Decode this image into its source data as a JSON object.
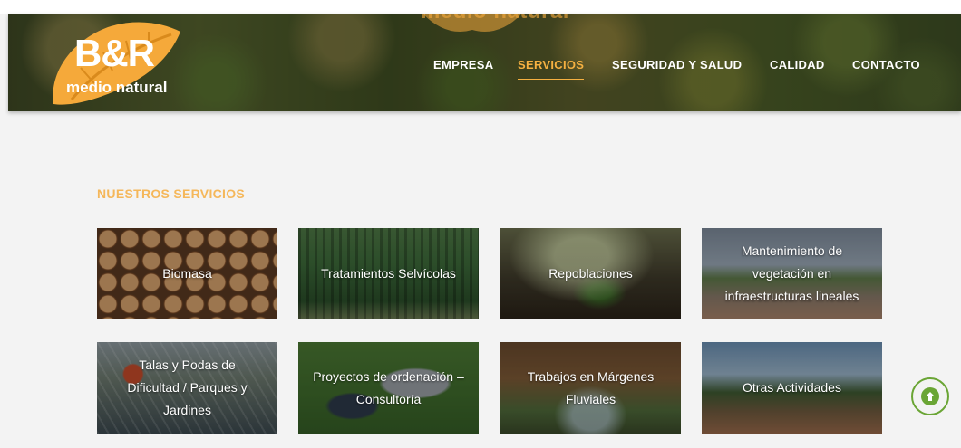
{
  "header": {
    "logo_main": "B&R",
    "logo_sub": "medio natural",
    "ghost_logo": "medio natural",
    "nav": [
      {
        "label": "EMPRESA",
        "active": false
      },
      {
        "label": "SERVICIOS",
        "active": true
      },
      {
        "label": "SEGURIDAD Y SALUD",
        "active": false
      },
      {
        "label": "CALIDAD",
        "active": false
      },
      {
        "label": "CONTACTO",
        "active": false
      }
    ]
  },
  "services": {
    "title": "NUESTROS SERVICIOS",
    "items": [
      {
        "label": "Biomasa"
      },
      {
        "label": "Tratamientos Selvícolas"
      },
      {
        "label": "Repoblaciones"
      },
      {
        "label": "Mantenimiento de vegetación en infraestructuras lineales"
      },
      {
        "label": "Talas y Podas de Dificultad / Parques y Jardines"
      },
      {
        "label": "Proyectos de ordenación – Consultoría"
      },
      {
        "label": "Trabajos en Márgenes Fluviales"
      },
      {
        "label": "Otras Actividades"
      }
    ]
  },
  "scroll_top": {
    "icon": "arrow-up-icon"
  },
  "colors": {
    "accent_orange": "#f5b041",
    "accent_green": "#6aa535",
    "page_bg": "#f3f3f3"
  }
}
